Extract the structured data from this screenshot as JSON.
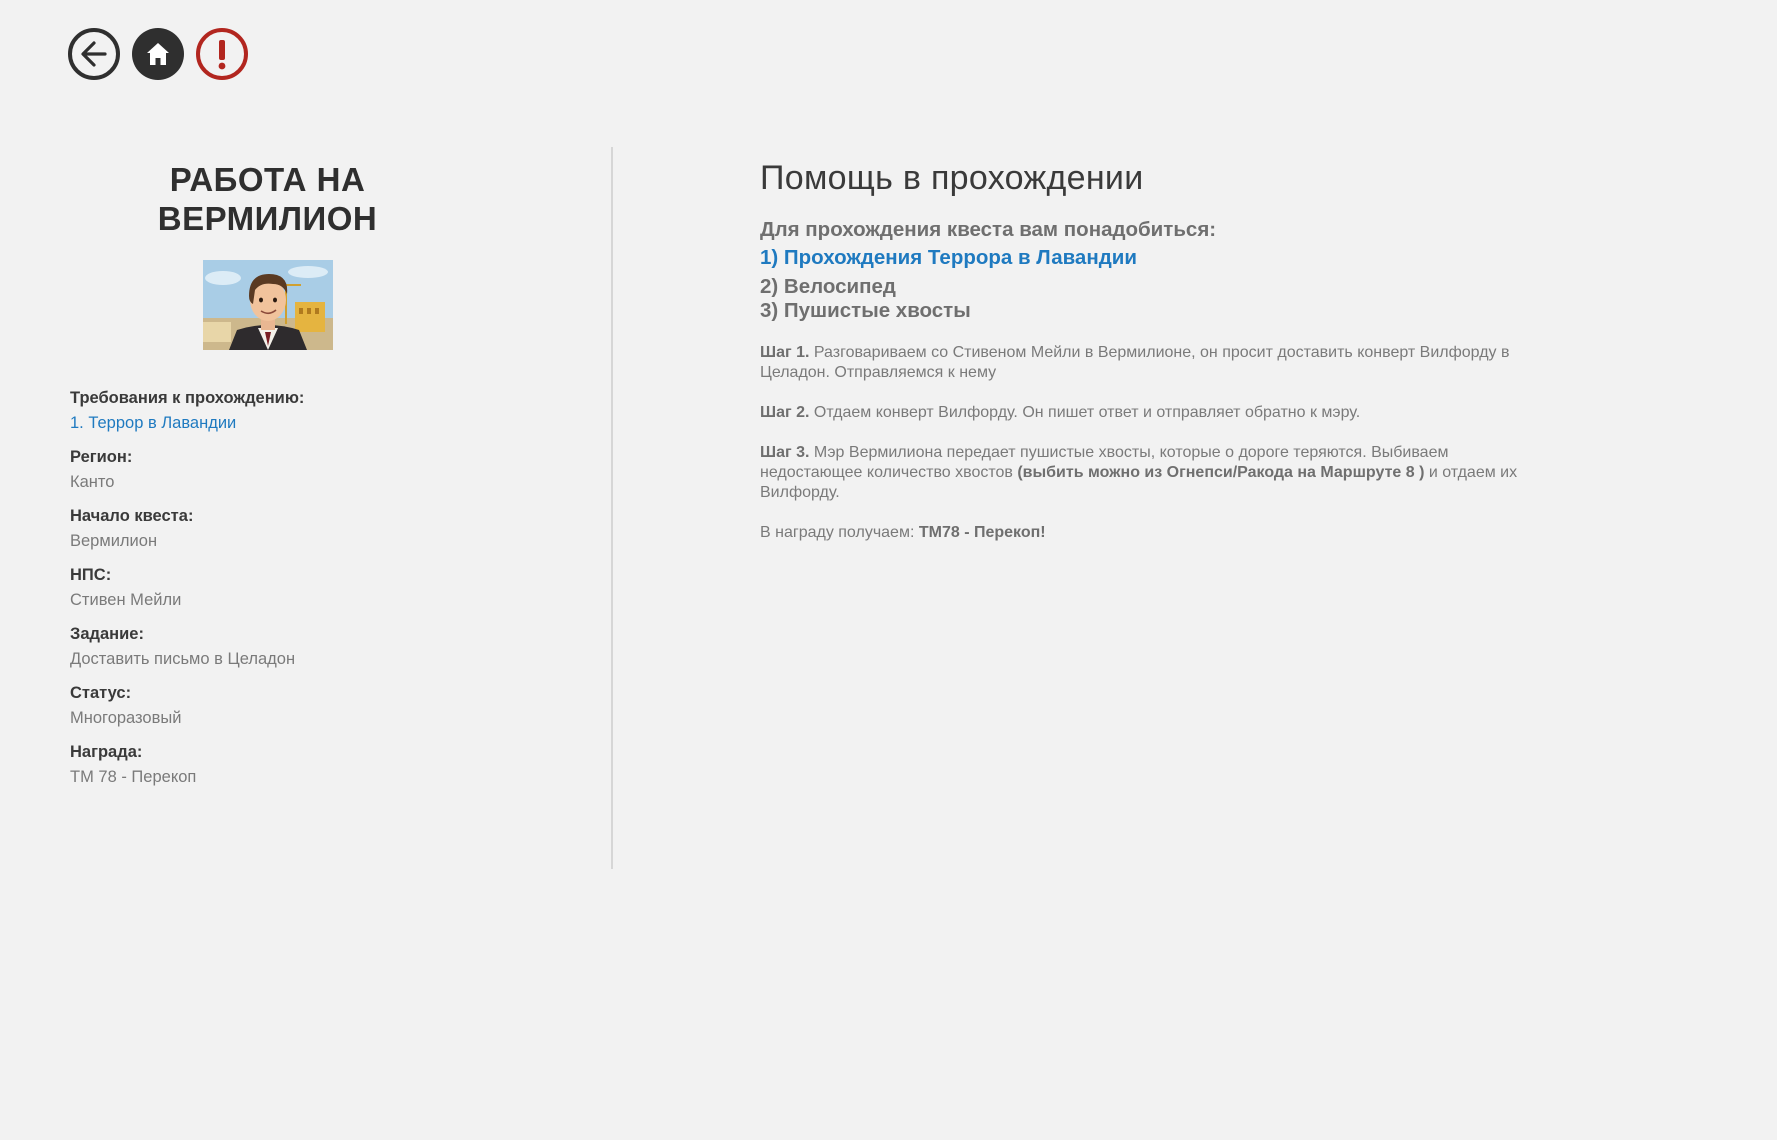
{
  "nav": {
    "back_label": "Назад",
    "home_label": "Главная",
    "report_label": "Сообщить об ошибке"
  },
  "quest": {
    "title_line1": "РАБОТА НА",
    "title_line2": "ВЕРМИЛИОН",
    "portrait_alt": "Стивен Мейли"
  },
  "info": {
    "requirements_label": "Требования к прохождению:",
    "requirements_value": "1. Террор в Лавандии",
    "region_label": "Регион:",
    "region_value": "Канто",
    "start_label": "Начало квеста:",
    "start_value": "Вермилион",
    "npc_label": "НПС:",
    "npc_value": "Стивен Мейли",
    "task_label": "Задание:",
    "task_value": "Доставить письмо в Целадон",
    "status_label": "Статус:",
    "status_value": "Многоразовый",
    "reward_label": "Награда:",
    "reward_value": "ТМ 78 - Перекоп"
  },
  "help": {
    "title": "Помощь в прохождении",
    "needs_intro": "Для прохождения квеста вам понадобиться:",
    "need1": "1) Прохождения Террора в Лавандии",
    "need2": "2) Велосипед",
    "need3": "3) Пушистые хвосты",
    "step1_label": "Шаг 1.",
    "step1_text": " Разговариваем со Стивеном Мейли в Вермилионе, он просит доставить конверт Вилфорду в Целадон. Отправляемся к нему",
    "step2_label": "Шаг 2.",
    "step2_text": " Отдаем конверт Вилфорду. Он пишет ответ и отправляет обратно к мэру.",
    "step3_label": "Шаг 3.",
    "step3_text_a": " Мэр Вермилиона передает пушистые хвосты, которые о дороге теряются. Выбиваем недостающее количество хвостов ",
    "step3_bold": "(выбить можно из Огнепси/Ракода на Маршруте 8 )",
    "step3_text_b": " и отдаем их Вилфорду.",
    "reward_prefix": "В награду получаем: ",
    "reward_bold": "ТМ78 - Перекоп!"
  }
}
